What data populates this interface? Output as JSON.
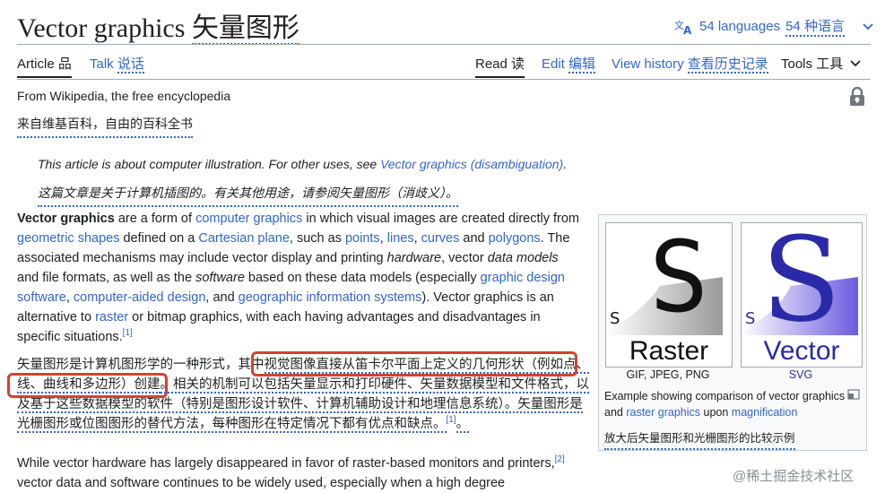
{
  "header": {
    "title_en": "Vector graphics",
    "title_zh": "矢量图形",
    "languages_en": "54 languages",
    "languages_zh": "54 种语言"
  },
  "tabs": {
    "article": "Article",
    "article_zh": "品",
    "talk": "Talk",
    "talk_zh": "说话",
    "read": "Read",
    "read_zh": "读",
    "edit": "Edit",
    "edit_zh": "编辑",
    "history": "View history",
    "history_zh": "查看历史记录",
    "tools": "Tools",
    "tools_zh": "工具"
  },
  "intro": {
    "from": "From Wikipedia, the free encyclopedia",
    "from_zh": "来自维基百科，自由的百科全书",
    "hatnote_prefix": "This article is about computer illustration. For other uses, see ",
    "hatnote_link": "Vector graphics (disambiguation)",
    "hatnote_suffix": ".",
    "hatnote_zh": "这篇文章是关于计算机插图的。有关其他用途，请参阅矢量图形（消歧义）。"
  },
  "p1": {
    "t1": "Vector graphics",
    "t2": " are a form of ",
    "l1": "computer graphics",
    "t3": " in which visual images are created directly from ",
    "l2": "geometric shapes",
    "t4": " defined on a ",
    "l3": "Cartesian plane",
    "t5": ", such as ",
    "l4": "points",
    "t6": ", ",
    "l5": "lines",
    "t7": ", ",
    "l6": "curves",
    "t8": " and ",
    "l7": "polygons",
    "t9": ". The associated mechanisms may include vector display and printing ",
    "i1": "hardware",
    "t10": ", vector ",
    "i2": "data models",
    "t11": " and file formats, as well as the ",
    "i3": "software",
    "t12": " based on these data models (especially ",
    "l8": "graphic design software",
    "t13": ", ",
    "l9": "computer-aided design",
    "t14": ", and ",
    "l10": "geographic information systems",
    "t15": "). Vector graphics is an alternative to ",
    "l11": "raster",
    "t16": " or bitmap graphics, with each having advantages and disadvantages in specific situations.",
    "ref": "[1]"
  },
  "p_zh": {
    "line1a": "矢量图形是计算机图形学的一种形式，其中",
    "line1b": "视觉图像直接从笛卡尔平面上定义的几何形状（例如点、",
    "line2a": "线、曲线和多边形）创建",
    "line2b": "。相关的机制可以包括矢量显示和打印硬件、矢量数据模型和文件格式，以",
    "line3": "及基于这些数据模型的软件（特别是图形设计软件、计算机辅助设计和地理信息系统）。矢量图形是",
    "line4": "光栅图形或位图图形的替代方法，每种图形在特定情况下都有优点和缺点。",
    "ref": "[1]",
    "end": "。"
  },
  "p2": {
    "t1": "While vector hardware has largely disappeared in favor of raster-based monitors and printers,",
    "ref": "[2]",
    "t2": " vector data and software continues to be widely used, especially when a high degree"
  },
  "figure": {
    "raster_letter": "S",
    "raster_small": "S",
    "raster_label": "Raster",
    "raster_formats": "GIF, JPEG, PNG",
    "vector_letter": "S",
    "vector_small": "S",
    "vector_label": "Vector",
    "vector_formats": "SVG",
    "caption_t1": "Example showing comparison of vector graphics and ",
    "caption_l1": "raster graphics",
    "caption_t2": " upon ",
    "caption_l2": "magnification",
    "caption_zh": "放大后矢量图形和光栅图形的比较示例"
  },
  "watermark": "@稀土掘金技术社区",
  "colors": {
    "link": "#3366cc",
    "highlight_box": "#d2432d",
    "vector_blue": "#2a2aa8"
  }
}
